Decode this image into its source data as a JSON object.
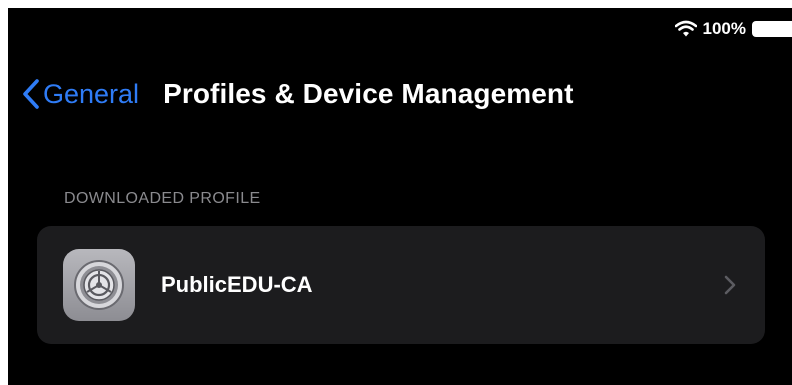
{
  "status_bar": {
    "wifi_icon": "wifi-icon",
    "battery_percent": "100%",
    "battery_icon": "battery-icon"
  },
  "nav": {
    "back_label": "General",
    "back_icon": "chevron-left-icon",
    "title": "Profiles & Device Management"
  },
  "section": {
    "header": "DOWNLOADED PROFILE"
  },
  "profiles": [
    {
      "name": "PublicEDU-CA",
      "icon": "settings-gear-icon",
      "disclosure_icon": "chevron-right-icon"
    }
  ],
  "colors": {
    "background": "#000000",
    "accent": "#2f7cf6",
    "row_background": "#1c1c1e",
    "secondary_text": "#8a8a8e"
  }
}
